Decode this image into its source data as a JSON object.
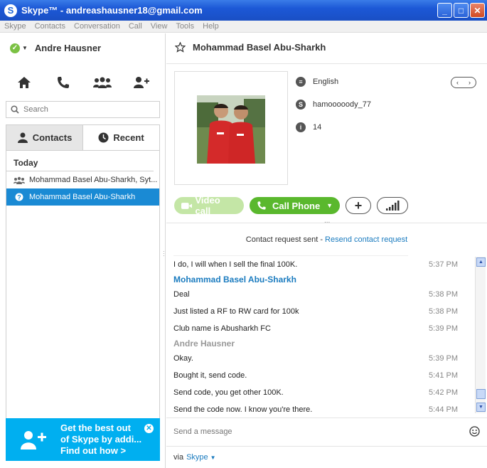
{
  "window": {
    "title": "Skype™ - andreashausner18@gmail.com",
    "logo_letter": "S",
    "minimize": "_",
    "maximize": "□",
    "close": "✕"
  },
  "menu": [
    "Skype",
    "Contacts",
    "Conversation",
    "Call",
    "View",
    "Tools",
    "Help"
  ],
  "sidebar": {
    "profile_name": "Andre Hausner",
    "status_check": "✓",
    "status_caret": "▼",
    "nav_icons": [
      "home-icon",
      "phone-icon",
      "group-icon",
      "add-contact-icon"
    ],
    "search_placeholder": "Search",
    "tabs": [
      {
        "label": "Contacts",
        "active": true
      },
      {
        "label": "Recent",
        "active": false
      }
    ],
    "list_heading": "Today",
    "items": [
      {
        "label": "Mohammad Basel Abu-Sharkh, Syt...",
        "icon": "group-icon",
        "selected": false
      },
      {
        "label": "Mohammad Basel Abu-Sharkh",
        "icon": "question-status-icon",
        "selected": true
      }
    ],
    "promo": {
      "line1": "Get the best out",
      "line2": "of Skype by addi...",
      "link": "Find out how >",
      "close": "✕"
    }
  },
  "contact": {
    "name": "Mohammad Basel Abu-Sharkh",
    "language": "English",
    "skype_name": "hamooooody_77",
    "age": "14",
    "language_icon_glyph": "≡",
    "skype_icon_glyph": "S",
    "info_icon_glyph": "i",
    "pager_prev": "‹",
    "pager_next": "›"
  },
  "actions": {
    "video_call": "Video call",
    "call_phone": "Call Phone",
    "call_phone_caret": "▼",
    "add": "+"
  },
  "chat": {
    "request_text": "Contact request sent - ",
    "request_link": "Resend contact request",
    "divider_dots": "...",
    "messages": [
      {
        "type": "msg",
        "text": "I do, I will when I sell the final 100K.",
        "time": "5:37 PM"
      },
      {
        "type": "sender",
        "text": "Mohammad Basel Abu-Sharkh",
        "style": "blue"
      },
      {
        "type": "msg",
        "text": "Deal",
        "time": "5:38 PM"
      },
      {
        "type": "msg",
        "text": "Just listed a RF to RW card for 100k",
        "time": "5:38 PM"
      },
      {
        "type": "msg",
        "text": "Club name is Abusharkh FC",
        "time": "5:39 PM"
      },
      {
        "type": "sender",
        "text": "Andre Hausner",
        "style": "gray"
      },
      {
        "type": "msg",
        "text": "Okay.",
        "time": "5:39 PM"
      },
      {
        "type": "msg",
        "text": "Bought it, send code.",
        "time": "5:41 PM"
      },
      {
        "type": "msg",
        "text": "Send code, you get other 100K.",
        "time": "5:42 PM"
      },
      {
        "type": "msg",
        "text": "Send the code now. I know you're there.",
        "time": "5:44 PM"
      }
    ],
    "compose_placeholder": "Send a message",
    "via_label": "via",
    "via_value": "Skype",
    "via_caret": "▼",
    "scroll_up": "▲",
    "scroll_down": "▼"
  }
}
